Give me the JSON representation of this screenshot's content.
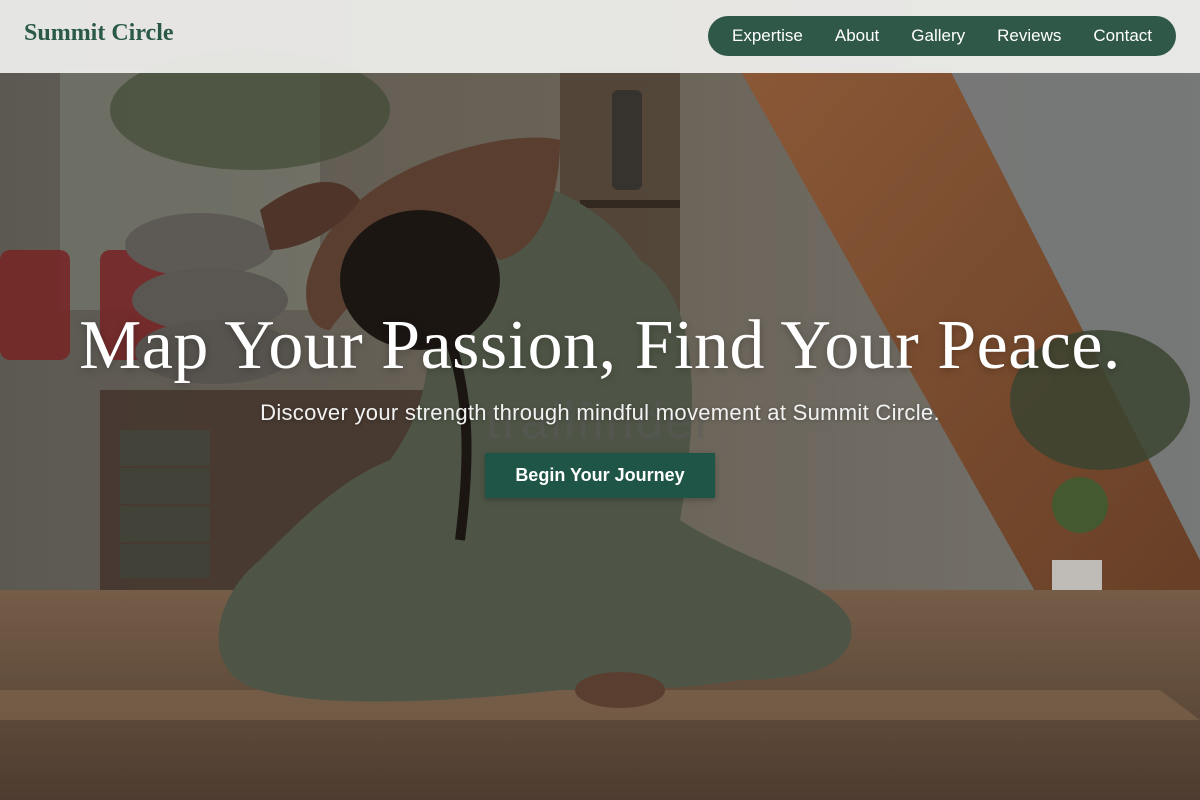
{
  "header": {
    "brand": "Summit Circle",
    "nav": [
      "Expertise",
      "About",
      "Gallery",
      "Reviews",
      "Contact"
    ]
  },
  "hero": {
    "headline": "Map Your Passion, Find Your Peace.",
    "watermark": "trailfinder",
    "subline": "Discover your strength through mindful movement at Summit Circle.",
    "cta": "Begin Your Journey",
    "image": "yoga-studio-photo"
  },
  "colors": {
    "brand": "#2a5a47",
    "nav_bg": "#2f5848",
    "cta_bg": "#1f5546",
    "header_bg": "#f0f0ee"
  }
}
